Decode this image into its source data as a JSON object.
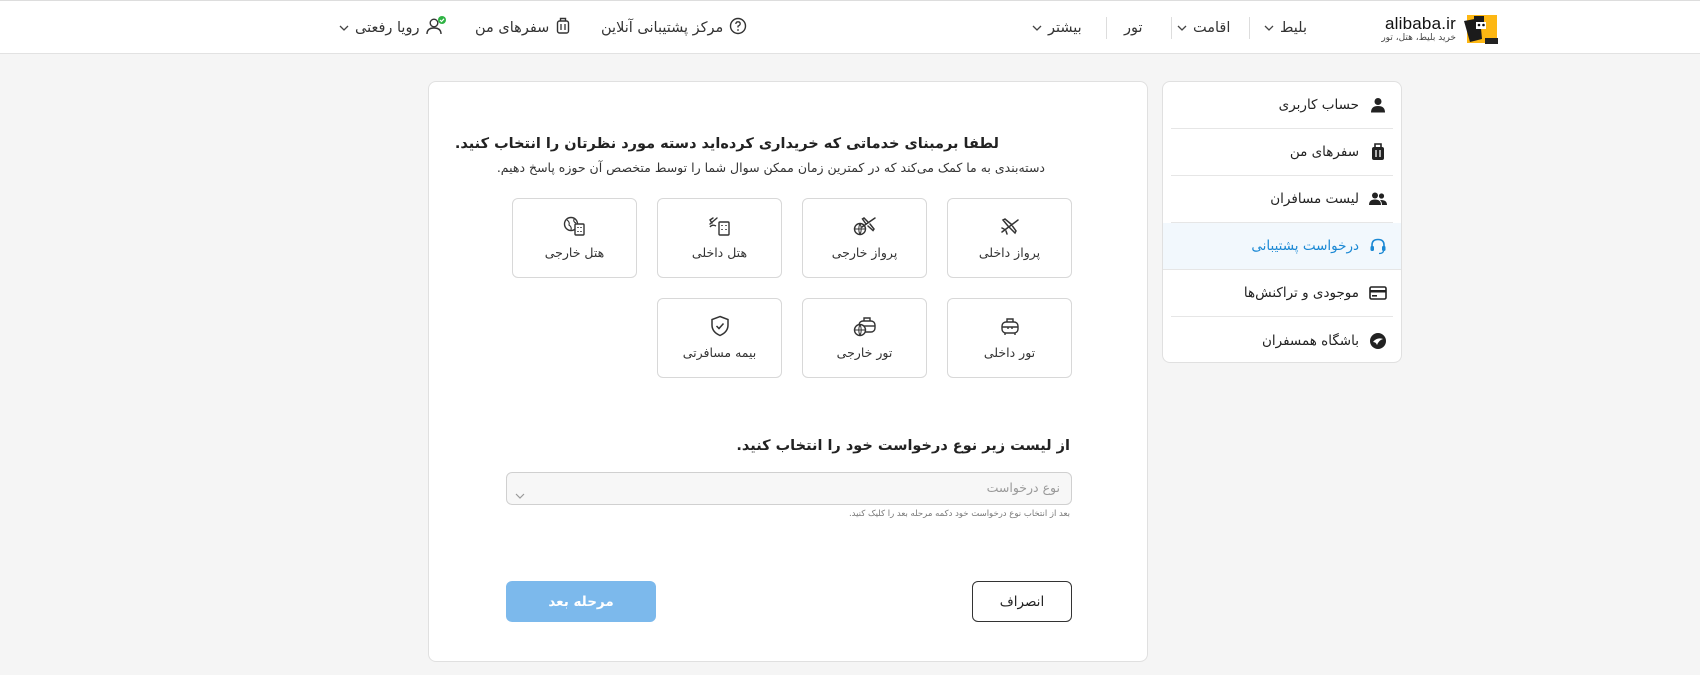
{
  "header": {
    "logo_text": "alibaba.ir",
    "logo_tagline": "خرید بلیط، هتل، تور",
    "nav": [
      {
        "label": "بلیط"
      },
      {
        "label": "اقامت"
      },
      {
        "label": "تور"
      },
      {
        "label": "بیشتر"
      }
    ],
    "support_center": "مرکز پشتیبانی آنلاین",
    "my_trips": "سفرهای من",
    "user_name": "رویا رفعتی",
    "online_color": "#2fb344"
  },
  "sidebar": {
    "items": [
      {
        "label": "حساب کاربری",
        "icon": "user-icon"
      },
      {
        "label": "سفرهای من",
        "icon": "suitcase-icon"
      },
      {
        "label": "لیست مسافران",
        "icon": "users-icon"
      },
      {
        "label": "درخواست پشتیبانی",
        "icon": "headset-icon",
        "active": true
      },
      {
        "label": "موجودی و تراکنش‌ها",
        "icon": "wallet-card-icon"
      },
      {
        "label": "باشگاه همسفران",
        "icon": "club-icon"
      }
    ],
    "active_color": "#1a88d4"
  },
  "main": {
    "title": "لطفا برمبنای خدماتی که خریداری کرده‌اید دسته مورد نظرتان را انتخاب کنید.",
    "subtitle": "دسته‌بندی به ما کمک می‌کند که در کمترین زمان ممکن سوال شما را توسط متخصص آن حوزه پاسخ دهیم.",
    "categories": [
      {
        "label": "پرواز داخلی",
        "icon": "domestic-flight-icon"
      },
      {
        "label": "پرواز خارجی",
        "icon": "international-flight-icon"
      },
      {
        "label": "هتل داخلی",
        "icon": "domestic-hotel-icon"
      },
      {
        "label": "هتل خارجی",
        "icon": "international-hotel-icon"
      },
      {
        "label": "تور داخلی",
        "icon": "domestic-tour-icon"
      },
      {
        "label": "تور خارجی",
        "icon": "international-tour-icon"
      },
      {
        "label": "بیمه مسافرتی",
        "icon": "insurance-shield-icon"
      }
    ],
    "request_section_title": "از لیست زیر نوع درخواست خود را انتخاب کنید.",
    "request_type_placeholder": "نوع درخواست",
    "hint": "بعد از انتخاب نوع درخواست خود دکمه مرحله بعد را کلیک کنید.",
    "cancel_label": "انصراف",
    "next_label": "مرحله بعد",
    "next_color": "#7cb9ec"
  }
}
